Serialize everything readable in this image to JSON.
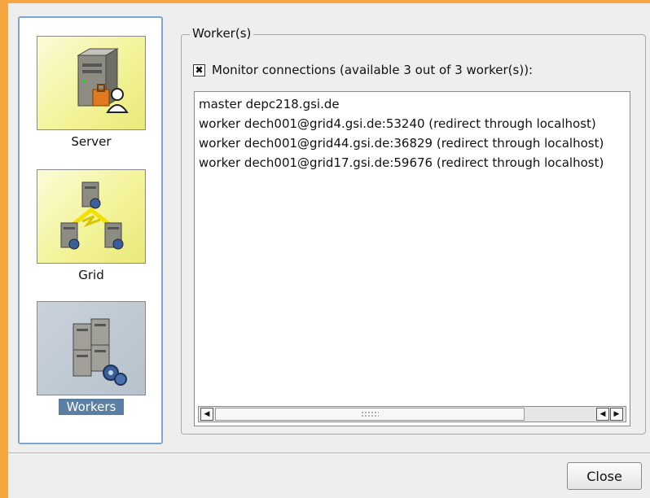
{
  "nav": {
    "items": [
      {
        "label": "Server",
        "icon": "server-icon"
      },
      {
        "label": "Grid",
        "icon": "grid-network-icon"
      },
      {
        "label": "Workers",
        "icon": "workers-cluster-icon",
        "selected": true
      }
    ]
  },
  "group": {
    "title": "Worker(s)",
    "monitor_checked": true,
    "monitor_label": "Monitor connections (available 3 out of 3 worker(s)):",
    "list_items": [
      "master depc218.gsi.de",
      "worker dech001@grid4.gsi.de:53240 (redirect through localhost)",
      "worker dech001@grid44.gsi.de:36829 (redirect through localhost)",
      "worker dech001@grid17.gsi.de:59676 (redirect through localhost)"
    ]
  },
  "footer": {
    "close_label": "Close"
  },
  "colors": {
    "selection": "#5b7ea3",
    "tile_yellow": "#f3f39a",
    "tile_selected": "#b7c2cc"
  }
}
